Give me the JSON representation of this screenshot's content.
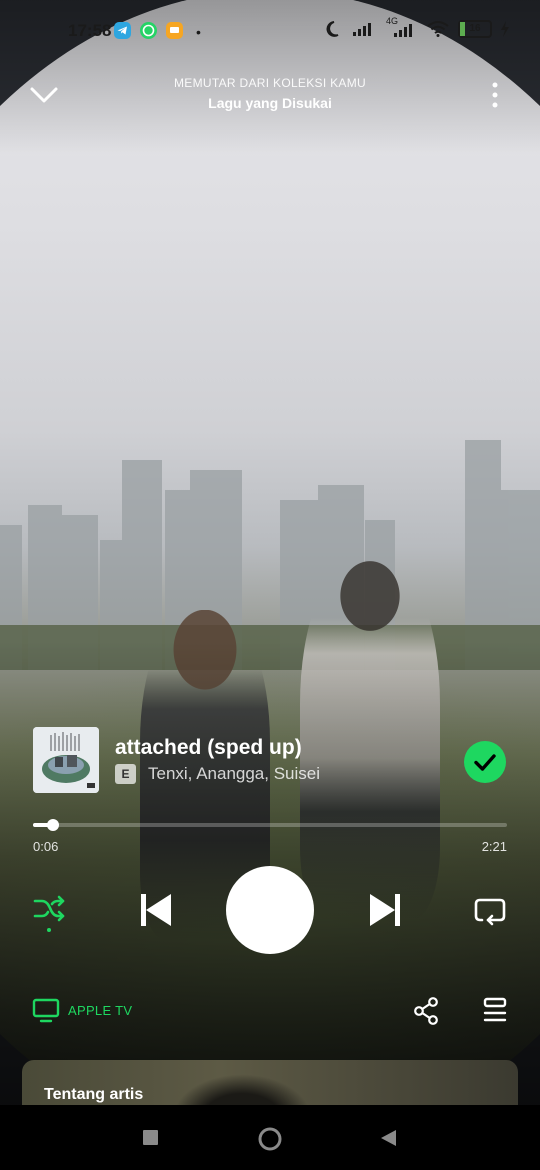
{
  "status_bar": {
    "time": "17:58",
    "network": "4G",
    "battery": "16",
    "battery_level_percent": 16,
    "app_icons": [
      "telegram-icon",
      "whatsapp-icon",
      "messages-icon"
    ]
  },
  "header": {
    "kicker": "MEMUTAR DARI KOLEKSI KAMU",
    "title": "Lagu yang Disukai"
  },
  "track": {
    "title": "attached (sped up)",
    "explicit_badge": "E",
    "artists": "Tenxi, Anangga, Suisei",
    "liked": true
  },
  "progress": {
    "elapsed": "0:06",
    "total": "2:21",
    "elapsed_seconds": 6,
    "total_seconds": 141
  },
  "device": {
    "label": "APPLE TV"
  },
  "about_artist": {
    "heading": "Tentang artis"
  },
  "colors": {
    "accent": "#1ed760",
    "text": "#ffffff",
    "navbar": "#000000"
  }
}
